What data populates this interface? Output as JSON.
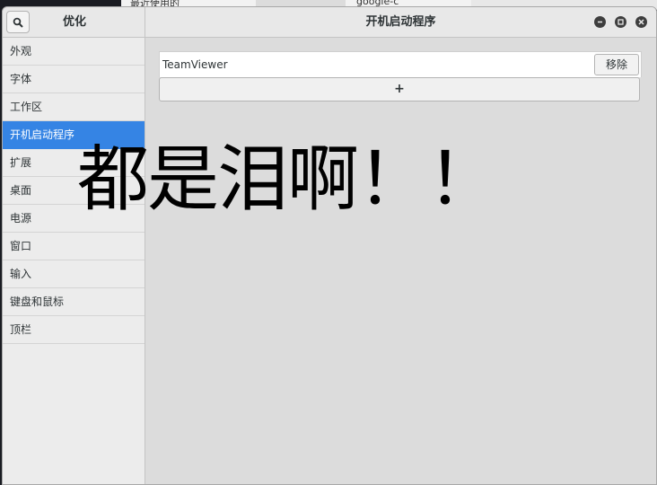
{
  "background_window": {
    "tab1_text": "最近使用的",
    "tab2_text": "google-c"
  },
  "window": {
    "app_title": "优化",
    "page_title": "开机启动程序"
  },
  "sidebar": {
    "items": [
      {
        "label": "外观"
      },
      {
        "label": "字体"
      },
      {
        "label": "工作区"
      },
      {
        "label": "开机启动程序",
        "active": true
      },
      {
        "label": "扩展"
      },
      {
        "label": "桌面"
      },
      {
        "label": "电源"
      },
      {
        "label": "窗口"
      },
      {
        "label": "输入"
      },
      {
        "label": "键盘和鼠标"
      },
      {
        "label": "顶栏"
      }
    ]
  },
  "startup_apps": [
    {
      "name": "TeamViewer",
      "remove_label": "移除"
    }
  ],
  "add_button_label": "+",
  "overlay": {
    "text": "都是泪啊！！"
  },
  "colors": {
    "accent": "#3584e4",
    "window_bg": "#dcdcdc",
    "sidebar_bg": "#ececec"
  },
  "icons": {
    "search": "search-icon",
    "minimize": "minimize-icon",
    "maximize": "maximize-icon",
    "close": "close-icon"
  }
}
